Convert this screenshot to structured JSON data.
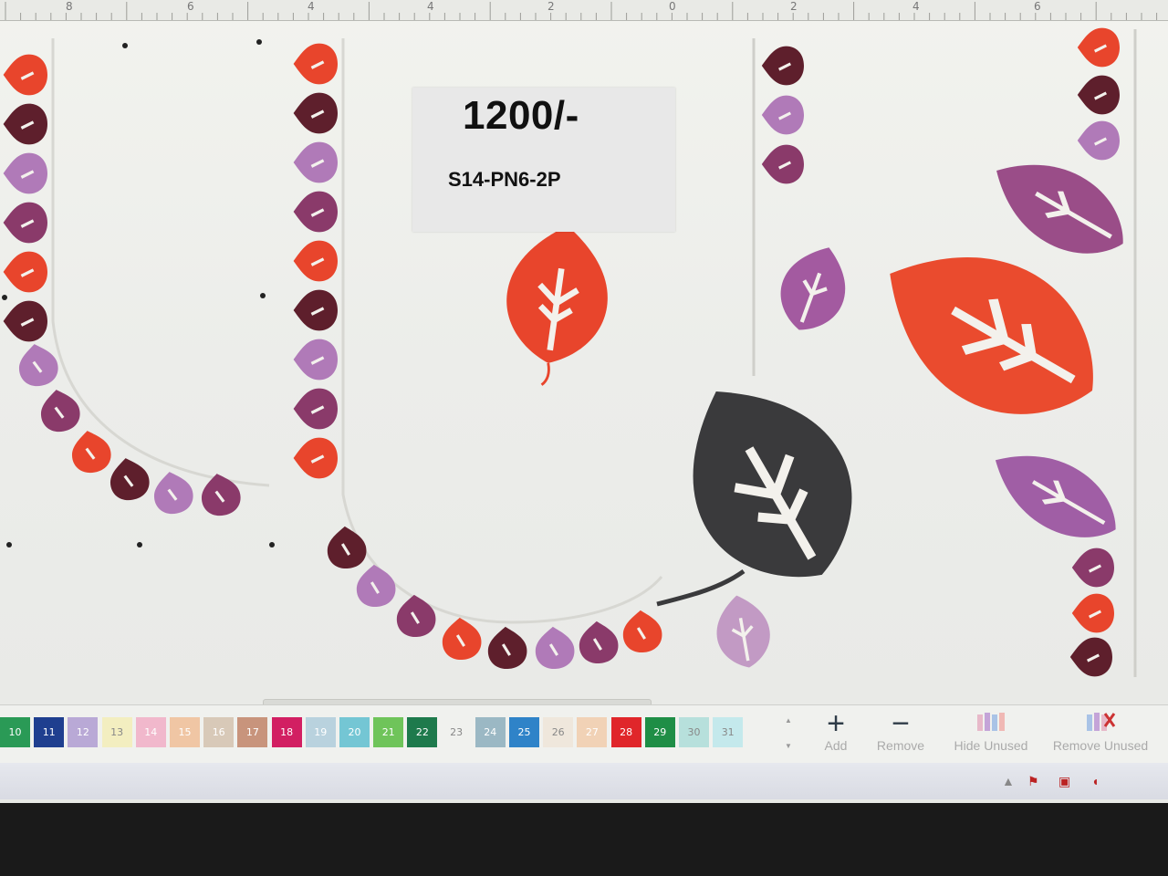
{
  "ruler": {
    "numbers": [
      "8",
      "6",
      "4",
      "4",
      "2",
      "0",
      "2",
      "4",
      "6"
    ]
  },
  "product_card": {
    "price": "1200/-",
    "code": "S14-PN6-2P"
  },
  "palette": {
    "swatches": [
      {
        "num": "10",
        "color": "#2a9a56"
      },
      {
        "num": "11",
        "color": "#1f3f8f"
      },
      {
        "num": "12",
        "color": "#b9a9d6"
      },
      {
        "num": "13",
        "color": "#f3eec0"
      },
      {
        "num": "14",
        "color": "#f1b8cc"
      },
      {
        "num": "15",
        "color": "#f0c6a4"
      },
      {
        "num": "16",
        "color": "#d8c9b8"
      },
      {
        "num": "17",
        "color": "#c8947c"
      },
      {
        "num": "18",
        "color": "#d21f62"
      },
      {
        "num": "19",
        "color": "#b9d2de"
      },
      {
        "num": "20",
        "color": "#74c6d4"
      },
      {
        "num": "21",
        "color": "#6fc45a"
      },
      {
        "num": "22",
        "color": "#1e7a4c"
      },
      {
        "num": "23",
        "color": "#f0f1ee"
      },
      {
        "num": "24",
        "color": "#9bb8c4"
      },
      {
        "num": "25",
        "color": "#2f83c8"
      },
      {
        "num": "26",
        "color": "#efe7dc"
      },
      {
        "num": "27",
        "color": "#f1d2b6"
      },
      {
        "num": "28",
        "color": "#e0262a"
      },
      {
        "num": "29",
        "color": "#1f8e46"
      },
      {
        "num": "30",
        "color": "#b7e0dc"
      },
      {
        "num": "31",
        "color": "#c4e9ec"
      }
    ]
  },
  "toolbar": {
    "add_label": "Add",
    "remove_label": "Remove",
    "hide_unused_label": "Hide Unused",
    "remove_unused_label": "Remove Unused"
  },
  "colors": {
    "orange": "#e8452c",
    "maroon": "#5e1f2c",
    "violet": "#b07ab8",
    "plum": "#8a3a6a",
    "charcoal": "#3a3a3c"
  },
  "icons": [
    "plus-icon",
    "minus-icon",
    "hide-unused-icon",
    "remove-unused-icon",
    "network-tray-icon",
    "flag-tray-icon",
    "volume-tray-icon"
  ]
}
